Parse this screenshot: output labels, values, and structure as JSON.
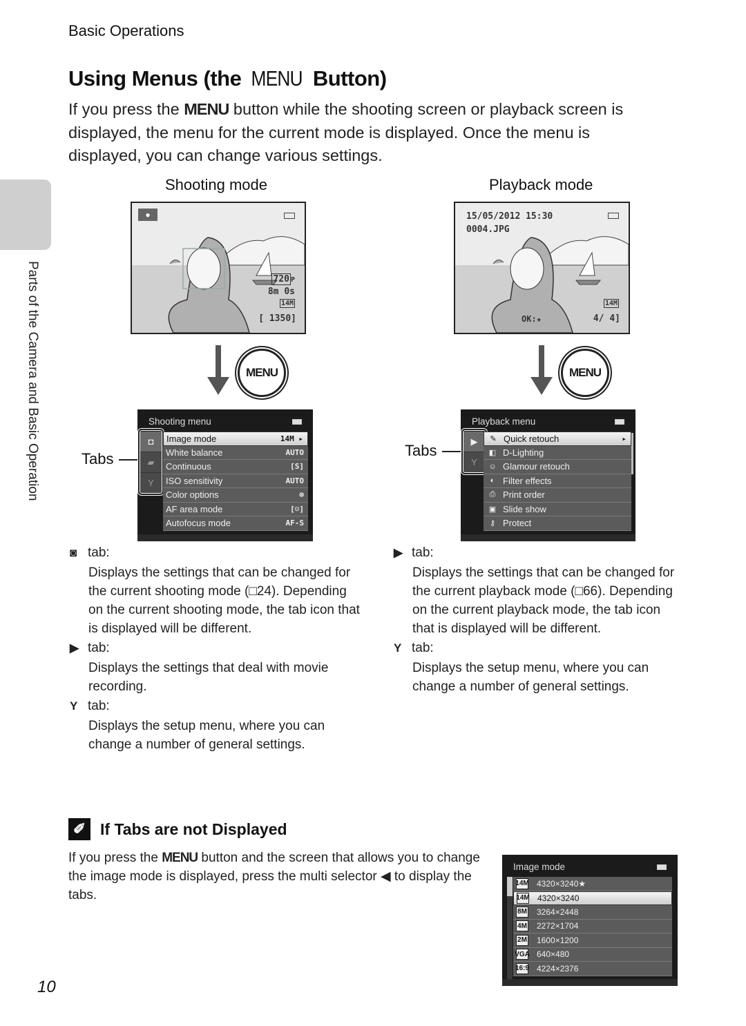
{
  "header": {
    "section": "Basic Operations",
    "title_prefix": "Using Menus (the ",
    "title_keyword": "MENU",
    "title_suffix": " Button)"
  },
  "intro": {
    "before": "If you press the ",
    "keyword": "MENU",
    "after": " button while the shooting screen or playback screen is displayed, the menu for the current mode is displayed. Once the menu is displayed, you can change various settings."
  },
  "side_tab": {
    "text": "Parts of the Camera and Basic Operation"
  },
  "shooting": {
    "mode_label": "Shooting mode",
    "screen": {
      "mode_icon": "camera-icon",
      "movie_size": "720",
      "movie_suffix": "P",
      "movie_time": "8m 0s",
      "image_size": "14M",
      "exposures": "[ 1350]"
    },
    "menu_button_label": "MENU",
    "menu": {
      "title": "Shooting menu",
      "tabs": [
        {
          "icon": "camera-icon",
          "glyph": "◘",
          "active": true
        },
        {
          "icon": "movie-icon",
          "glyph": "▰",
          "active": false
        },
        {
          "icon": "wrench-icon",
          "glyph": "Y",
          "active": false
        }
      ],
      "items": [
        {
          "label": "Image mode",
          "value": "14M ▸",
          "selected": true
        },
        {
          "label": "White balance",
          "value": "AUTO",
          "selected": false
        },
        {
          "label": "Continuous",
          "value": "[S]",
          "selected": false
        },
        {
          "label": "ISO sensitivity",
          "value": "AUTO",
          "selected": false
        },
        {
          "label": "Color options",
          "value": "⊗",
          "selected": false
        },
        {
          "label": "AF area mode",
          "value": "[☺]",
          "selected": false
        },
        {
          "label": "Autofocus mode",
          "value": "AF-S",
          "selected": false
        }
      ]
    },
    "tabs_label": "Tabs",
    "descriptions": [
      {
        "icon": "camera-icon",
        "glyph": "◙",
        "head": "tab:",
        "body": "Displays the settings that can be changed for the current shooting mode (□24). Depending on the current shooting mode, the tab icon that is displayed will be different."
      },
      {
        "icon": "movie-icon",
        "glyph": "▶",
        "head": "tab:",
        "body": "Displays the settings that deal with movie recording."
      },
      {
        "icon": "wrench-icon",
        "glyph": "Y",
        "head": "tab:",
        "body": "Displays the setup menu, where you can change a number of general settings."
      }
    ]
  },
  "playback": {
    "mode_label": "Playback mode",
    "screen": {
      "datetime": "15/05/2012 15:30",
      "filename": "0004.JPG",
      "image_size": "14M",
      "ok_hint": "OK:★",
      "frame_count": "4/   4]"
    },
    "menu_button_label": "MENU",
    "menu": {
      "title": "Playback menu",
      "tabs": [
        {
          "icon": "play-icon",
          "glyph": "▶",
          "active": true
        },
        {
          "icon": "wrench-icon",
          "glyph": "Y",
          "active": false
        }
      ],
      "items": [
        {
          "icon": "quick-retouch-icon",
          "glyph": "✎",
          "label": "Quick retouch",
          "value": "▸",
          "selected": true
        },
        {
          "icon": "d-lighting-icon",
          "glyph": "◧",
          "label": "D-Lighting",
          "value": "",
          "selected": false
        },
        {
          "icon": "glamour-retouch-icon",
          "glyph": "☺",
          "label": "Glamour retouch",
          "value": "",
          "selected": false
        },
        {
          "icon": "filter-effects-icon",
          "glyph": "◐",
          "label": "Filter effects",
          "value": "",
          "selected": false
        },
        {
          "icon": "print-order-icon",
          "glyph": "⎙",
          "label": "Print order",
          "value": "",
          "selected": false
        },
        {
          "icon": "slide-show-icon",
          "glyph": "▣",
          "label": "Slide show",
          "value": "",
          "selected": false
        },
        {
          "icon": "protect-icon",
          "glyph": "⚷",
          "label": "Protect",
          "value": "",
          "selected": false
        }
      ]
    },
    "tabs_label": "Tabs",
    "descriptions": [
      {
        "icon": "play-icon",
        "glyph": "▶",
        "head": "tab:",
        "body": "Displays the settings that can be changed for the current playback mode (□66). Depending on the current playback mode, the tab icon that is displayed will be different."
      },
      {
        "icon": "wrench-icon",
        "glyph": "Y",
        "head": "tab:",
        "body": "Displays the setup menu, where you can change a number of general settings."
      }
    ]
  },
  "note": {
    "icon": "paperclip-icon",
    "title": "If Tabs are not Displayed",
    "body_before": "If you press the ",
    "body_keyword": "MENU",
    "body_after": " button and the screen that allows you to change the image mode is displayed, press the multi selector ◀ to display the tabs."
  },
  "image_mode_menu": {
    "title": "Image mode",
    "items": [
      {
        "badge": "14M",
        "label": "4320×3240★",
        "selected": false
      },
      {
        "badge": "14M",
        "label": "4320×3240",
        "selected": true
      },
      {
        "badge": "8M",
        "label": "3264×2448",
        "selected": false
      },
      {
        "badge": "4M",
        "label": "2272×1704",
        "selected": false
      },
      {
        "badge": "2M",
        "label": "1600×1200",
        "selected": false
      },
      {
        "badge": "VGA",
        "label": "640×480",
        "selected": false
      },
      {
        "badge": "16:9",
        "label": "4224×2376",
        "selected": false
      }
    ]
  },
  "page_number": "10"
}
